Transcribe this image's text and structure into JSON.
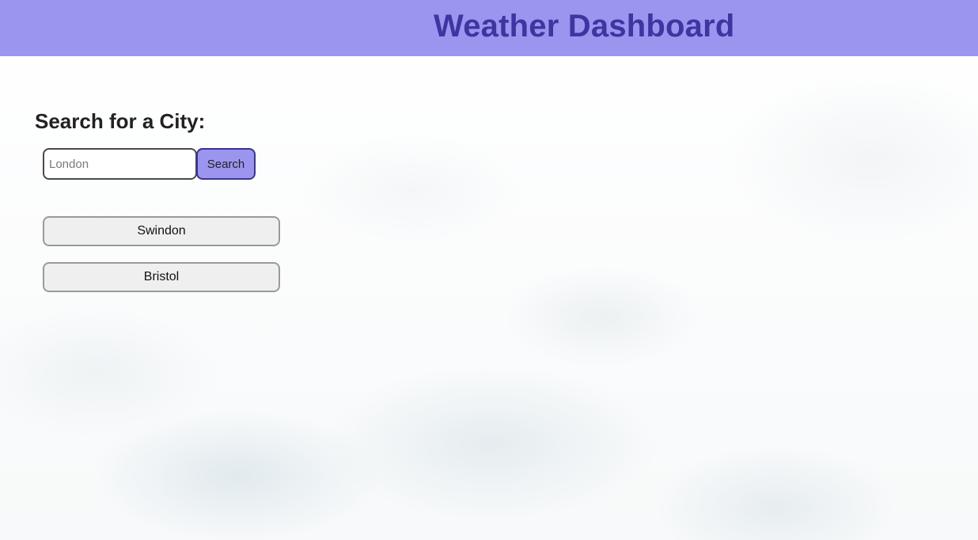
{
  "header": {
    "title": "Weather Dashboard",
    "background_color": "#9b95f0",
    "title_color": "#3f35a0"
  },
  "search": {
    "heading": "Search for a City:",
    "input_value": "",
    "placeholder": "London",
    "button_label": "Search"
  },
  "history": {
    "items": [
      {
        "label": "Swindon"
      },
      {
        "label": "Bristol"
      }
    ]
  }
}
